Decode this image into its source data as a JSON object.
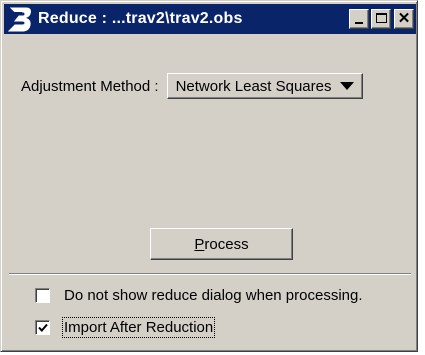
{
  "window": {
    "title": "Reduce : ...trav2\\trav2.obs",
    "titlebar_color": "#0a246a",
    "face_color": "#d4d0c8",
    "icon": "bentley-b-icon",
    "buttons": {
      "minimize": "minimize",
      "maximize": "maximize",
      "close": "✕"
    }
  },
  "adjustment": {
    "label": "Adjustment Method :",
    "selected": "Network Least Squares"
  },
  "process_button": {
    "label_first": "P",
    "label_rest": "rocess"
  },
  "options": [
    {
      "label": "Do not show reduce dialog when processing.",
      "checked": false
    },
    {
      "label": "Import After Reduction",
      "checked": true
    }
  ]
}
